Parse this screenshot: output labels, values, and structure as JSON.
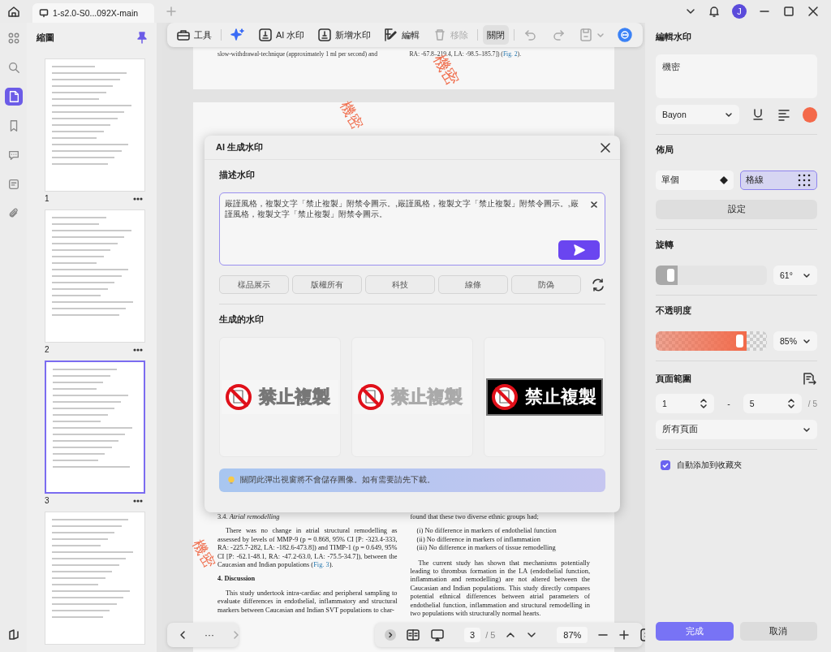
{
  "tab_bar": {
    "tab_title": "1-s2.0-S0...092X-main",
    "avatar": "J"
  },
  "rail": [
    {
      "kind": "grid",
      "selected": false
    },
    {
      "kind": "search",
      "selected": false
    },
    {
      "kind": "page",
      "selected": true
    },
    {
      "kind": "bookmark",
      "selected": false
    },
    {
      "kind": "comment",
      "selected": false
    },
    {
      "kind": "stamp",
      "selected": false
    },
    {
      "kind": "attachment",
      "selected": false
    }
  ],
  "sidebar": {
    "title": "縮圖",
    "thumbnails": [
      {
        "label": "1",
        "selected": false
      },
      {
        "label": "2",
        "selected": false
      },
      {
        "label": "3",
        "selected": true
      },
      {
        "selected": false
      }
    ]
  },
  "toolbar": [
    {
      "kind": "tools",
      "label": "工具",
      "disabled": false
    },
    {
      "kind": "sparkle"
    },
    {
      "kind": "ai",
      "label": "AI 水印",
      "disabled": false
    },
    {
      "kind": "add",
      "label": "新增水印",
      "disabled": false
    },
    {
      "kind": "edit",
      "label": "編輯",
      "disabled": false
    },
    {
      "kind": "remove",
      "label": "移除",
      "disabled": true
    },
    {
      "kind": "close",
      "label": "關閉",
      "disabled": false
    },
    {
      "kind": "undo",
      "disabled": true
    },
    {
      "kind": "redo",
      "disabled": true
    },
    {
      "kind": "save",
      "disabled": true
    },
    {
      "kind": "assistant"
    }
  ],
  "document": {
    "top_left": "slow-withdrawal-technique (approximately 1 ml per second) and",
    "top_right": {
      "text": "RA: -67.8–219.4, LA: -98.5–185.7]) (",
      "link": "Fig. 2",
      "after": ")."
    },
    "stamps": [
      "機密",
      "機密",
      "機密"
    ],
    "left_column": [
      {
        "kind": "heading",
        "text": "3.4.  *Atrial remodelling*"
      },
      {
        "kind": "paragraph",
        "text": "There was no change in atrial structural remodelling as assessed by levels of MMP-9 (p = 0.868, 95% CI [P: -323.4-333, RA: -225.7-282, LA: -182.6-473.8]) and TIMP-1 (p = 0.649, 95% CI [P: -62.1-48.1, RA: -47.2-63.0, LA: -75.5-34.7]), between the Caucasian and Indian populations (",
        "link": "Fig. 3",
        "after": ")."
      },
      {
        "kind": "heading",
        "text": "**4.  Discussion**"
      },
      {
        "kind": "paragraph",
        "text": "This study undertook intra-cardiac and peripheral sampling to evaluate differences in endothelial, inflammatory and structural markers between Caucasian and Indian SVT populations to char-"
      }
    ],
    "right_column": [
      {
        "kind": "line",
        "text": "found that these two diverse ethnic groups had;"
      },
      {
        "kind": "list",
        "items": [
          "(i) No difference in markers of endothelial function",
          "(ii) No difference in markers of inflammation",
          "(iii) No difference in markers of tissue remodelling"
        ]
      },
      {
        "kind": "paragraph",
        "text": "The current study has shown that mechanisms potentially leading to thrombus formation in the LA (endothelial function, inflammation and remodelling) are not altered between the Caucasian and Indian populations. This study directly compares potential ethnical differences between atrial parameters of endothelial function, inflammation and structural remodelling in two populations with structurally normal hearts."
      }
    ]
  },
  "dialog": {
    "title": "AI 生成水印",
    "describe_label": "描述水印",
    "prompt": "嚴謹風格，複製文字「禁止複製」附禁令圖示。,嚴謹風格，複製文字「禁止複製」附禁令圖示。,嚴謹風格，複製文字「禁止複製」附禁令圖示。",
    "chips": [
      "樣品展示",
      "版權所有",
      "科技",
      "線條",
      "防偽"
    ],
    "generated_label": "生成的水印",
    "results": [
      {
        "kind": "light",
        "text": "禁止複製"
      },
      {
        "kind": "faded",
        "text": "禁止複製"
      },
      {
        "kind": "dark",
        "text": "禁止複製"
      }
    ],
    "note": "關閉此彈出視窗將不會儲存圖像。如有需要請先下載。"
  },
  "panel": {
    "title": "編輯水印",
    "text_value": "機密",
    "font": "Bayon",
    "color": "#f4694a",
    "layout_label": "佈局",
    "layouts": [
      {
        "kind": "single",
        "label": "單個",
        "selected": false
      },
      {
        "kind": "grid",
        "label": "格線",
        "selected": true
      }
    ],
    "settings_button": "設定",
    "rotation_label": "旋轉",
    "rotation": {
      "level": 0.2,
      "value": "61°"
    },
    "opacity_label": "不透明度",
    "opacity": {
      "level": 0.82,
      "value": "85%"
    },
    "range_label": "頁面範圍",
    "range_from": "1",
    "range_dash": "-",
    "range_to": "5",
    "range_total": "/ 5",
    "range_select": "所有頁面",
    "auto_add": {
      "label": "自動添加到收藏夾",
      "checked": true
    },
    "done": "完成",
    "cancel": "取消"
  },
  "bottom_bar": {
    "more": "···",
    "page": "3",
    "total": "/ 5",
    "zoom": "87%"
  }
}
